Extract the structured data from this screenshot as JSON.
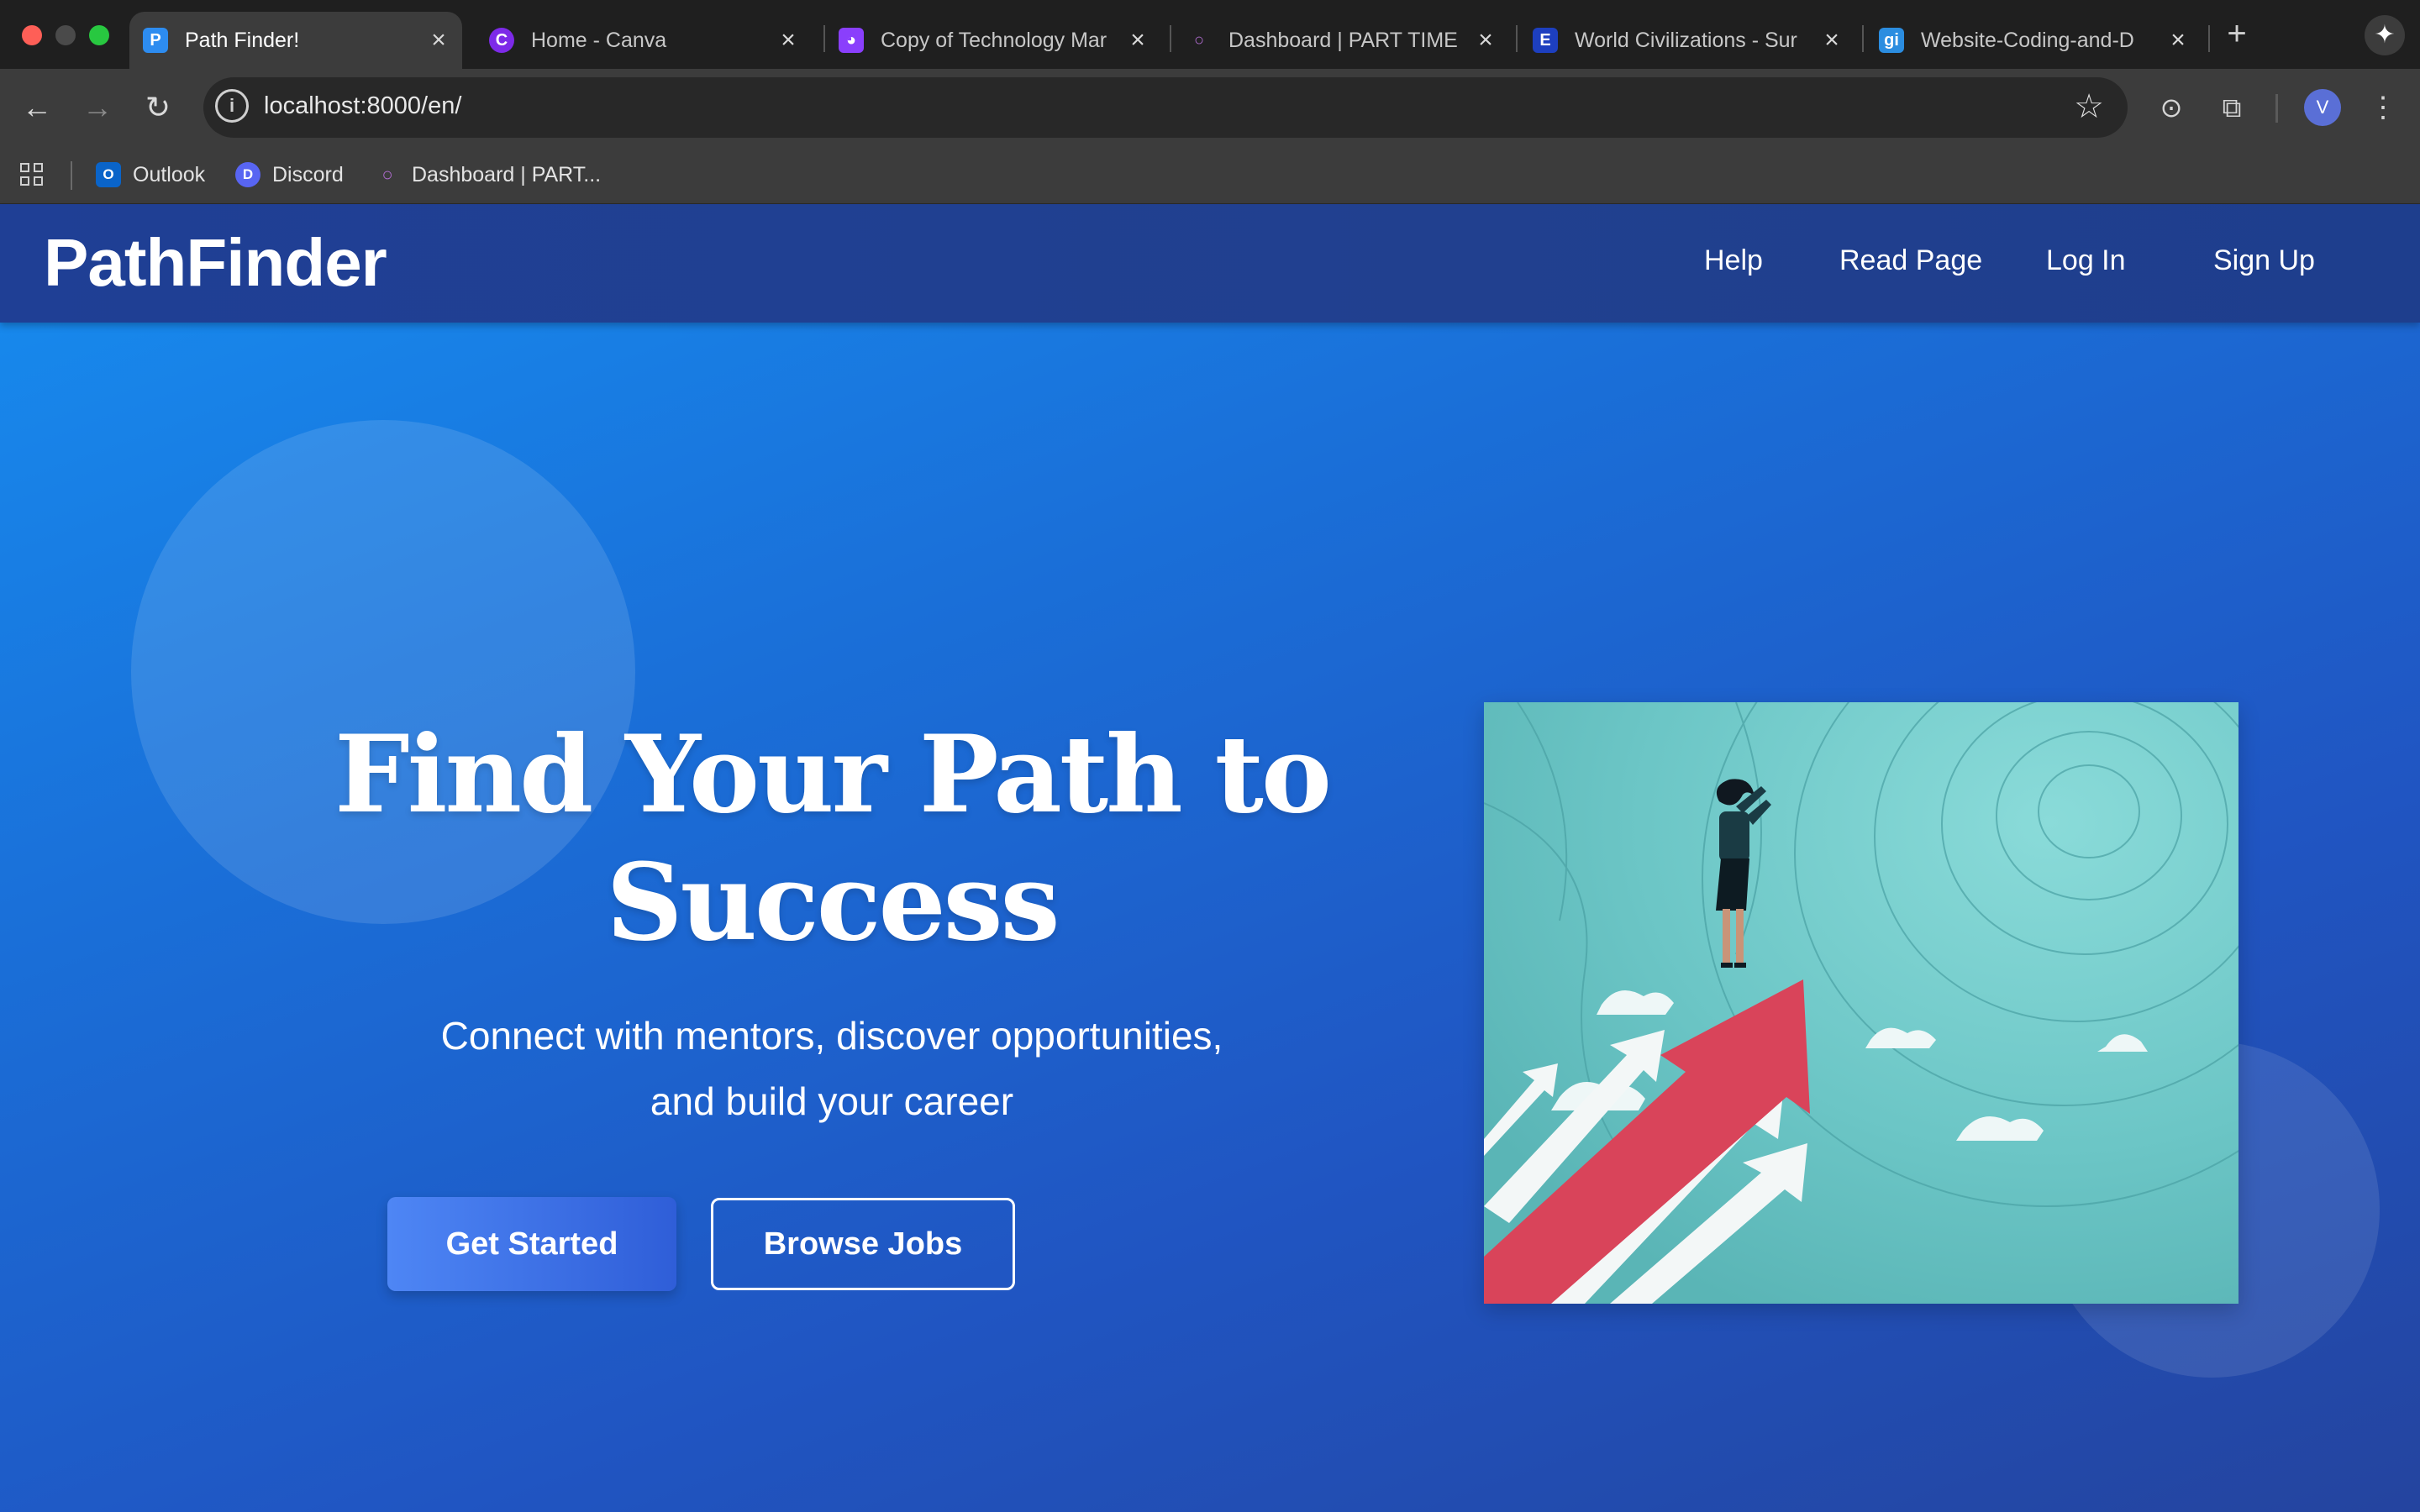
{
  "browser": {
    "tabs": [
      {
        "title": "Path Finder!",
        "icon": "P",
        "icon_color": "#2d8cf0",
        "active": true
      },
      {
        "title": "Home - Canva",
        "icon": "C",
        "icon_color": "#7d2ae8",
        "active": false
      },
      {
        "title": "Copy of Technology Mar",
        "icon": "◕",
        "icon_color": "#8a3ffc",
        "active": false
      },
      {
        "title": "Dashboard | PART TIME",
        "icon": "○",
        "icon_color": "#7a3fa0",
        "active": false
      },
      {
        "title": "World Civilizations - Sur",
        "icon": "E",
        "icon_color": "#1d3fbf",
        "active": false
      },
      {
        "title": "Website-Coding-and-D",
        "icon": "gi",
        "icon_color": "#2b8de0",
        "active": false
      }
    ],
    "url": "localhost:8000/en/",
    "avatar_letter": "V",
    "bookmarks": [
      {
        "label": "Outlook",
        "icon": "O",
        "icon_color": "#0a64c9"
      },
      {
        "label": "Discord",
        "icon": "D",
        "icon_color": "#5865f2"
      },
      {
        "label": "Dashboard | PART...",
        "icon": "○",
        "icon_color": "#7a3fa0"
      }
    ]
  },
  "site": {
    "logo": "PathFinder",
    "nav": [
      "Help",
      "Read Page",
      "Log In",
      "Sign Up"
    ]
  },
  "hero": {
    "title_line1": "Find Your Path to",
    "title_line2": "Success",
    "subtitle_line1": "Connect with mentors, discover opportunities,",
    "subtitle_line2": "and build your career",
    "primary_button": "Get Started",
    "secondary_button": "Browse Jobs"
  }
}
